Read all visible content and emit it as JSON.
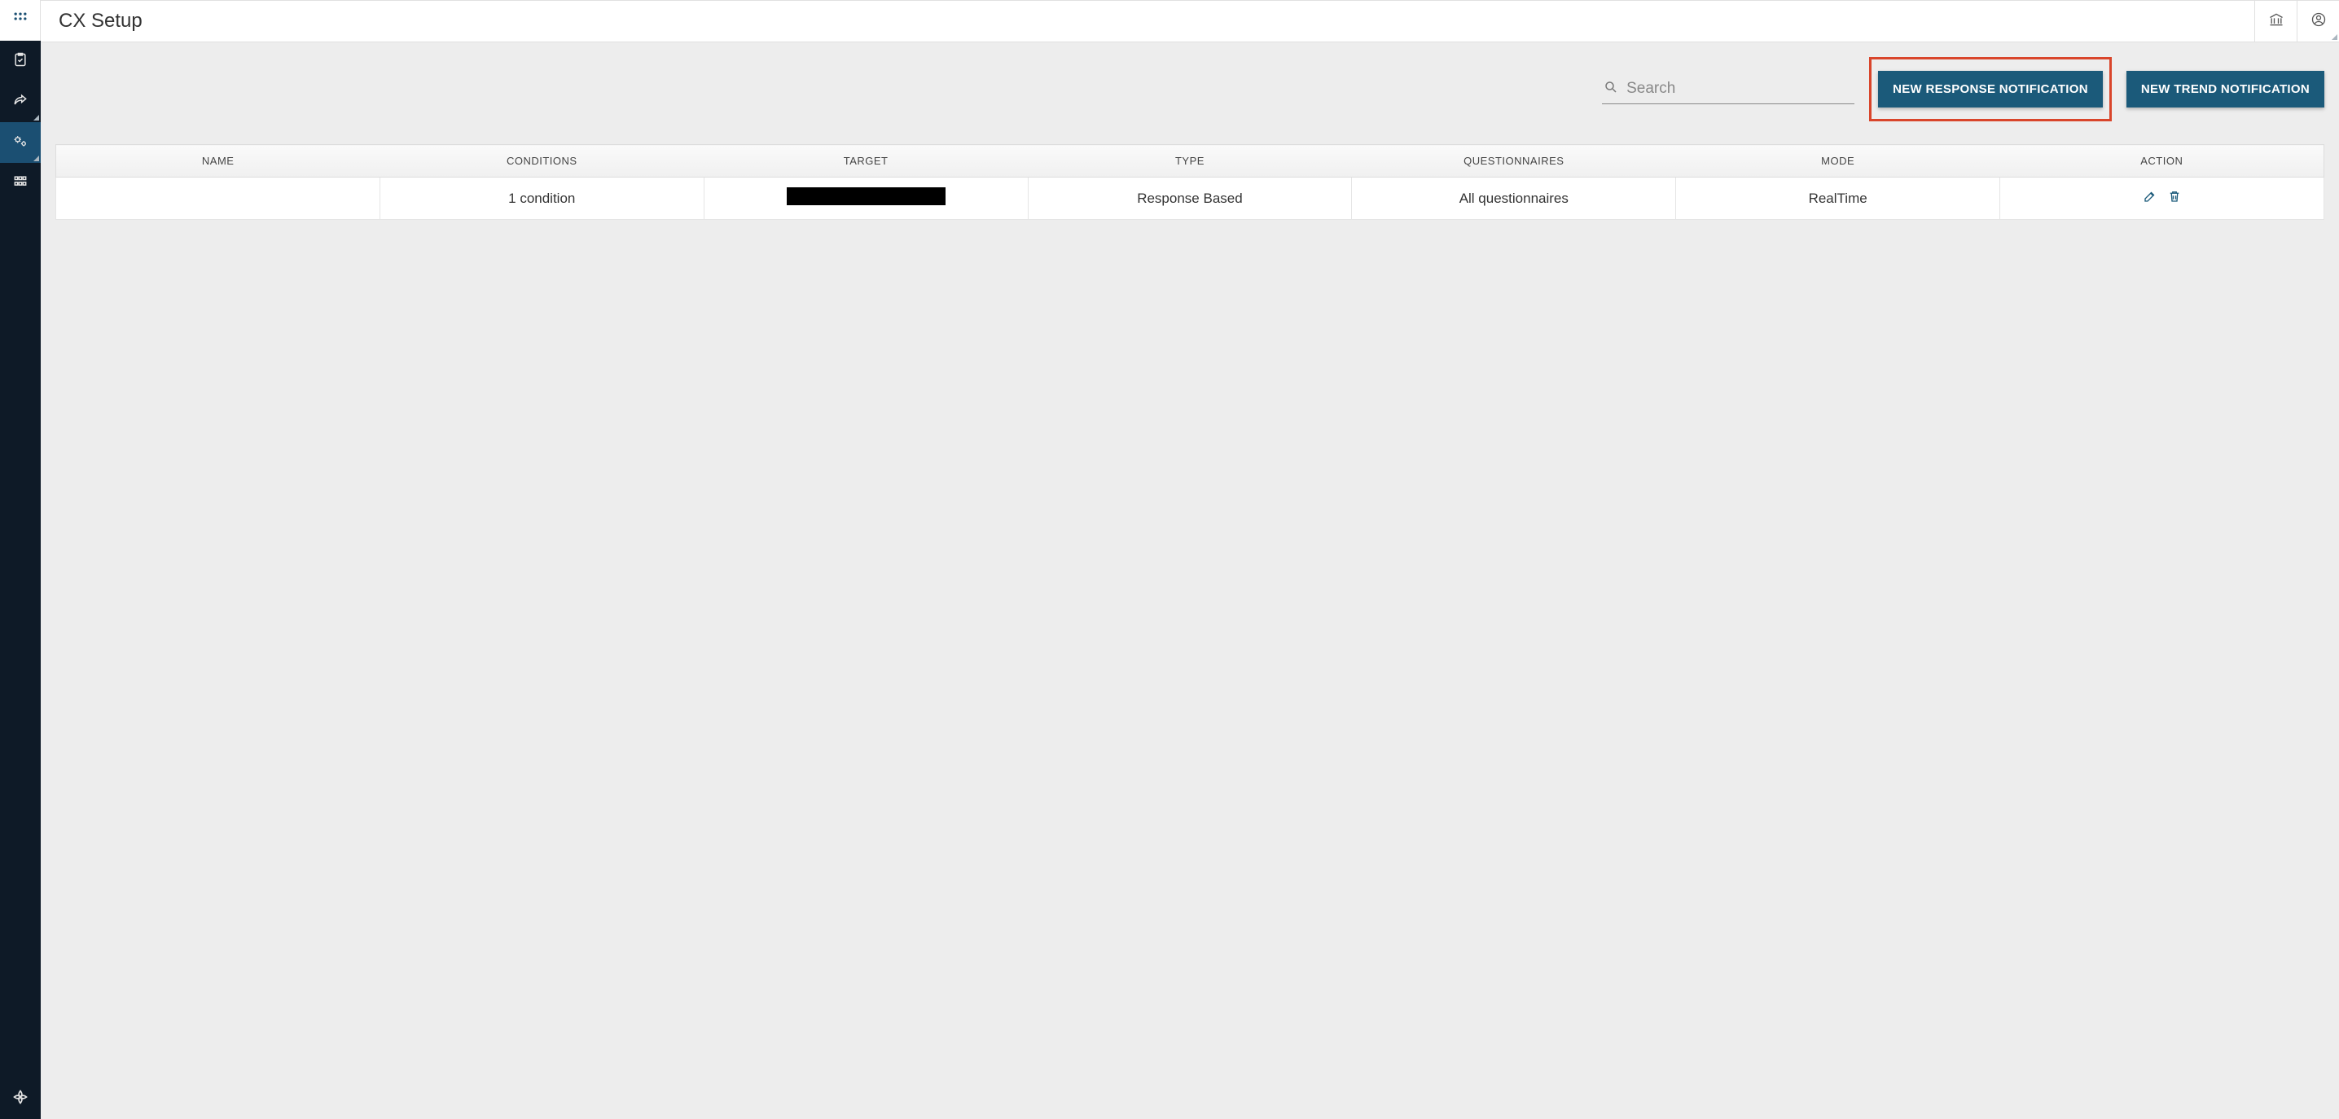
{
  "header": {
    "title": "CX Setup"
  },
  "search": {
    "placeholder": "Search",
    "value": ""
  },
  "buttons": {
    "new_response": "NEW RESPONSE NOTIFICATION",
    "new_trend": "NEW TREND NOTIFICATION"
  },
  "table": {
    "columns": {
      "name": "NAME",
      "conditions": "CONDITIONS",
      "target": "TARGET",
      "type": "TYPE",
      "questionnaires": "QUESTIONNAIRES",
      "mode": "MODE",
      "action": "ACTION"
    },
    "rows": [
      {
        "name": "",
        "conditions": "1 condition",
        "target": "",
        "type": "Response Based",
        "questionnaires": "All questionnaires",
        "mode": "RealTime"
      }
    ]
  }
}
